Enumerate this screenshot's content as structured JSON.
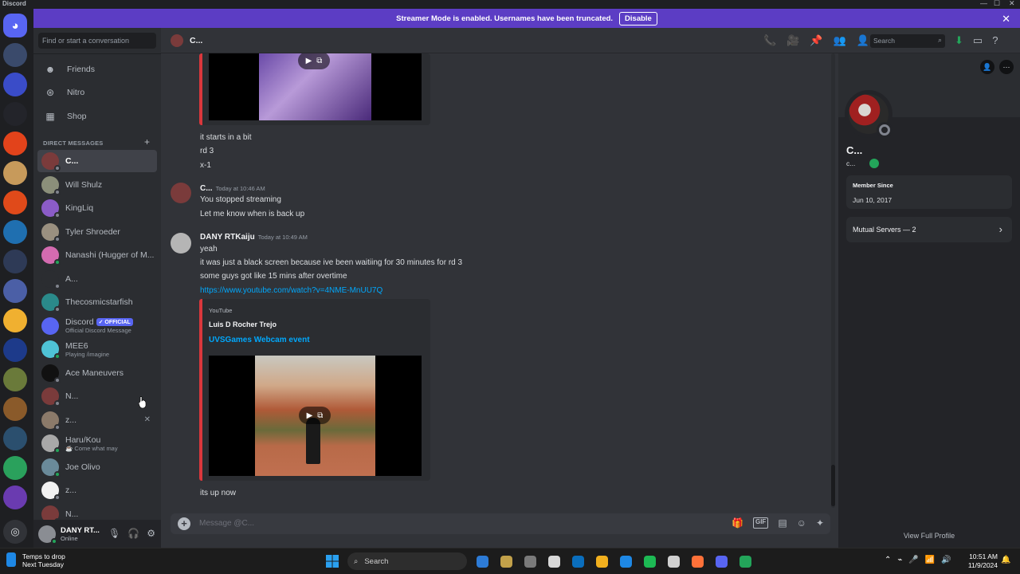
{
  "window": {
    "app_name": "Discord",
    "controls": [
      "—",
      "☐",
      "✕"
    ]
  },
  "banner": {
    "text": "Streamer Mode is enabled. Usernames have been truncated.",
    "button": "Disable",
    "close": "✕"
  },
  "guilds": {
    "colors": [
      "#5865f2",
      "#3a4a6b",
      "#3a4cc8",
      "#23242a",
      "#e2431b",
      "#c79a5b",
      "#e04a1a",
      "#1f6fb0",
      "#2e3a56",
      "#4b5fa6",
      "#f0b030",
      "#1d3a8a",
      "#6a7a3a",
      "#8a5a2a",
      "#2b4f6e",
      "#2aa15c",
      "#6a3bb0",
      "#23a55a"
    ]
  },
  "dm_sidebar": {
    "search_placeholder": "Find or start a conversation",
    "nav": [
      {
        "label": "Friends",
        "icon": "friends-icon",
        "glyph": "☻"
      },
      {
        "label": "Nitro",
        "icon": "nitro-icon",
        "glyph": "⊛"
      },
      {
        "label": "Shop",
        "icon": "shop-icon",
        "glyph": "▦"
      }
    ],
    "header": "DIRECT MESSAGES",
    "header_plus": "+",
    "dms": [
      {
        "name": "C...",
        "sub": "",
        "color": "#7a3b3b",
        "status": "#80848e",
        "active": true
      },
      {
        "name": "Will Shulz",
        "sub": "",
        "color": "#8b8f7a",
        "status": "#80848e"
      },
      {
        "name": "KingLiq",
        "sub": "",
        "color": "#8b5cc8",
        "status": "#80848e"
      },
      {
        "name": "Tyler Shroeder",
        "sub": "",
        "color": "#9a9080",
        "status": "#80848e"
      },
      {
        "name": "Nanashi (Hugger of M...",
        "sub": "",
        "color": "#d46bb0",
        "status": "#23a55a"
      },
      {
        "name": "A...",
        "sub": "",
        "color": "#2b2d31",
        "status": "#80848e"
      },
      {
        "name": "Thecosmicstarfish",
        "sub": "",
        "color": "#2a8a8a",
        "status": "#80848e"
      },
      {
        "name": "Discord",
        "sub": "Official Discord Message",
        "color": "#5865f2",
        "status": "",
        "badge": "✓ OFFICIAL"
      },
      {
        "name": "MEE6",
        "sub": "Playing /imagine",
        "color": "#4fc3d6",
        "status": "#23a55a"
      },
      {
        "name": "Ace Maneuvers",
        "sub": "",
        "color": "#111111",
        "status": "#80848e"
      },
      {
        "name": "N...",
        "sub": "",
        "color": "#7a3b3b",
        "status": "#80848e"
      },
      {
        "name": "z...",
        "sub": "",
        "color": "#8b7a6a",
        "status": "#80848e",
        "close": "✕"
      },
      {
        "name": "Haru/Kou",
        "sub": "☕ Come what may",
        "color": "#a8a8a8",
        "status": "#23a55a"
      },
      {
        "name": "Joe Olivo",
        "sub": "",
        "color": "#6a8a9a",
        "status": "#23a55a"
      },
      {
        "name": "z...",
        "sub": "",
        "color": "#f2f2f2",
        "status": "#80848e"
      },
      {
        "name": "N...",
        "sub": "",
        "color": "#7a3b3b",
        "status": "#80848e"
      }
    ]
  },
  "user_panel": {
    "name": "DANY RT...",
    "status": "Online",
    "icons": [
      "🎙",
      "🎧",
      "⚙"
    ]
  },
  "chat_header": {
    "title": "C...",
    "icons": [
      "📞",
      "🎥",
      "📌",
      "👥",
      "👤"
    ],
    "search_placeholder": "Search",
    "search_glyph": "⌕",
    "right_icons": [
      "⬇",
      "▭",
      "?"
    ]
  },
  "messages": {
    "group1_lines": [
      "it starts in a bit",
      "rd 3",
      "x-1"
    ],
    "group2": {
      "author": "C...",
      "time": "Today at 10:46 AM",
      "lines": [
        "You stopped streaming",
        "Let me know when is back up"
      ]
    },
    "group3": {
      "author": "DANY RTKaiju",
      "time": "Today at 10:49 AM",
      "lines": [
        "yeah",
        "it was just a black screen because ive been waitiing for 30 minutes for rd 3",
        "some guys got like 15 mins after overtime"
      ],
      "link": "https://www.youtube.com/watch?v=4NME-MnUU7Q",
      "embed": {
        "provider": "YouTube",
        "author": "Luis D Rocher Trejo",
        "title": "UVSGames Webcam event"
      },
      "after": "its up now"
    },
    "play_glyph": "▶",
    "open_glyph": "⧉"
  },
  "composer": {
    "placeholder": "Message @C...",
    "plus": "+",
    "icons": [
      "🎁",
      "GIF",
      "▤",
      "☺",
      "✦"
    ]
  },
  "profile": {
    "name": "C...",
    "username": "c...",
    "member_since_label": "Member Since",
    "member_since": "Jun 10, 2017",
    "mutual": "Mutual Servers — 2",
    "chevron": "›",
    "view_full": "View Full Profile",
    "top_icons": [
      "👤",
      "⋯"
    ]
  },
  "taskbar": {
    "weather_line1": "Temps to drop",
    "weather_line2": "Next Tuesday",
    "search": "Search",
    "apps": [
      "#2d7bd6",
      "#c2a14a",
      "#7a7a7a",
      "#d8d8d8",
      "#0a6ebd",
      "#f2b01e",
      "#1e88e5",
      "#1db954",
      "#d0d0d0",
      "#ff7139",
      "#5865f2",
      "#23a55a"
    ],
    "tray": [
      "⌃",
      "⌁",
      "🎤",
      "📶",
      "🔊",
      "🔋"
    ],
    "time": "10:51 AM",
    "date": "11/9/2024",
    "bell": "🔔"
  }
}
